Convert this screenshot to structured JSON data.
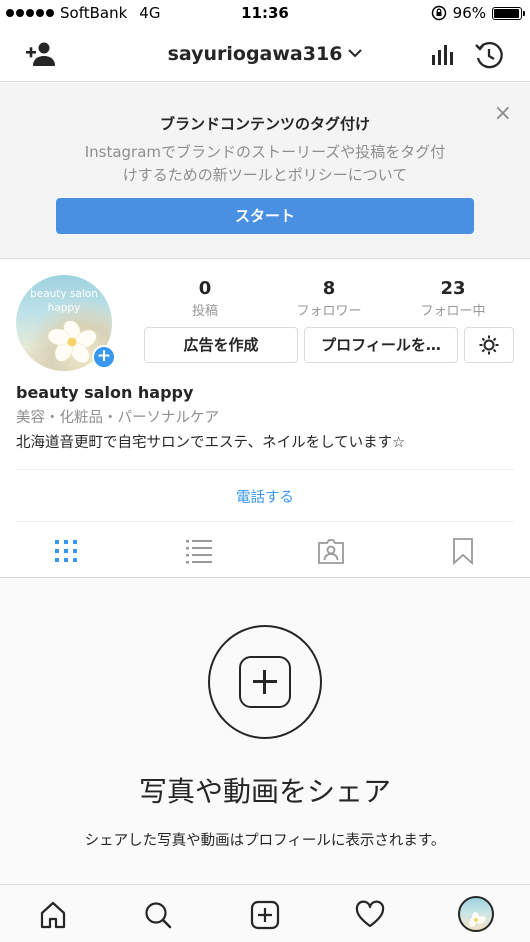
{
  "status_bar": {
    "carrier": "SoftBank",
    "network": "4G",
    "time": "11:36",
    "battery": "96%",
    "battery_level": 0.96
  },
  "nav": {
    "username": "sayuriogawa316",
    "icons": [
      "add-user-icon",
      "chevron-down-icon",
      "insights-icon",
      "archive-icon"
    ]
  },
  "banner": {
    "title": "ブランドコンテンツのタグ付け",
    "description_line1": "Instagramでブランドのストーリーズや投稿をタグ付",
    "description_line2": "けするための新ツールとポリシーについて",
    "start_label": "スタート",
    "close_label": "×",
    "accent": "#4a90e2"
  },
  "profile": {
    "avatar_text_line1": "beauty salon",
    "avatar_text_line2": "happy",
    "stats": [
      {
        "num": "0",
        "label": "投稿"
      },
      {
        "num": "8",
        "label": "フォロワー"
      },
      {
        "num": "23",
        "label": "フォロー中"
      }
    ],
    "create_ad_label": "広告を作成",
    "edit_profile_label": "プロフィールを…",
    "name": "beauty salon happy",
    "category": "美容・化粧品・パーソナルケア",
    "bio": "北海道音更町で自宅サロンでエステ、ネイルをしています☆",
    "call_label": "電話する",
    "link_color": "#3897f0"
  },
  "tabs": [
    "grid-icon",
    "list-icon",
    "tagged-icon",
    "saved-icon"
  ],
  "empty_state": {
    "heading": "写真や動画をシェア",
    "subtext": "シェアした写真や動画はプロフィールに表示されます。"
  },
  "tab_bar": [
    "home-icon",
    "search-icon",
    "new-post-icon",
    "activity-icon",
    "profile-icon"
  ]
}
